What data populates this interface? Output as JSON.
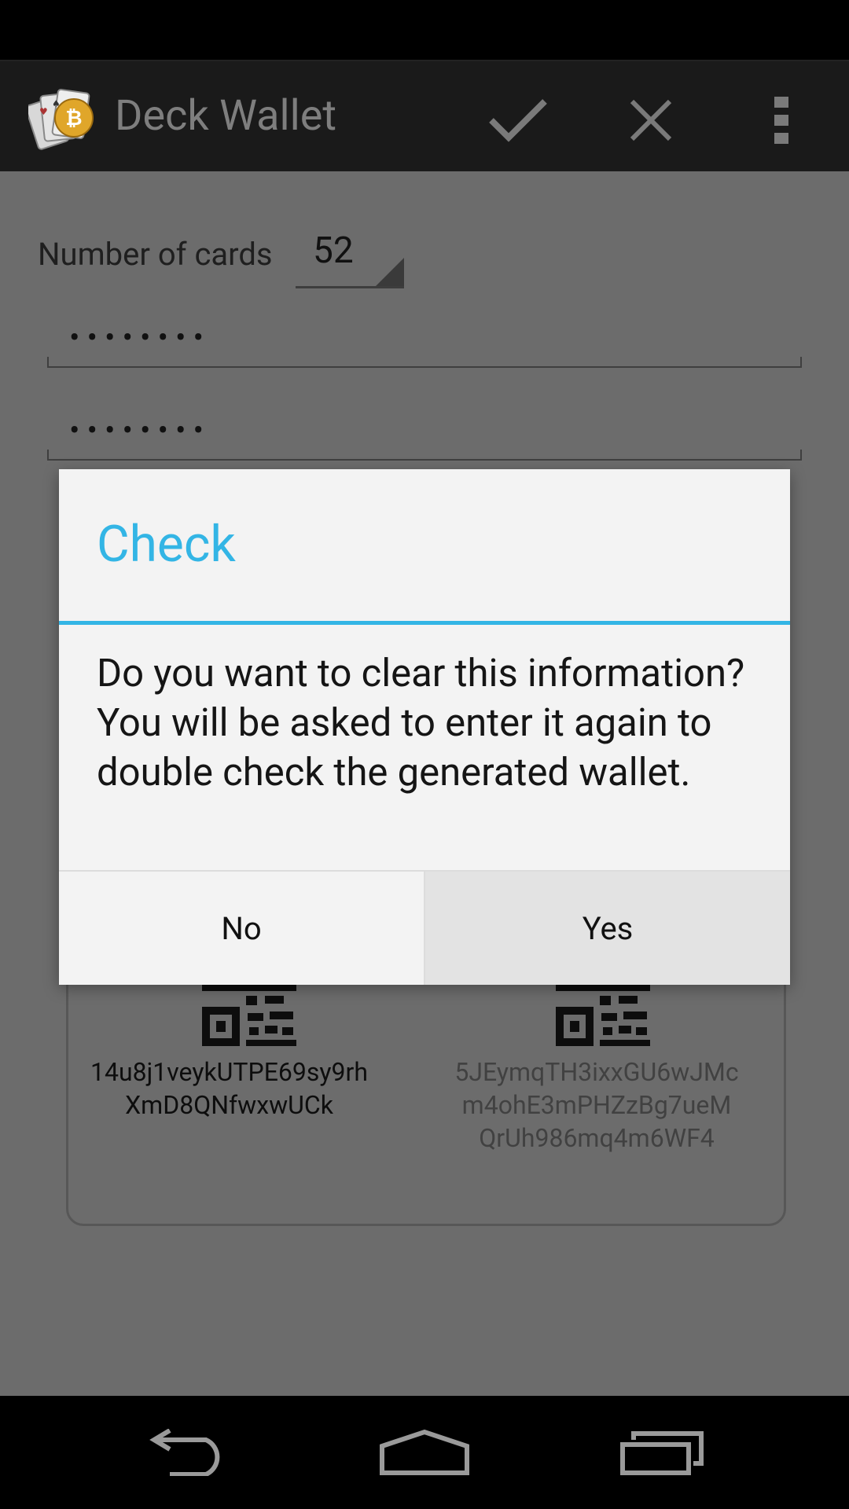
{
  "app": {
    "title": "Deck Wallet",
    "icons": [
      "playing-cards-bitcoin-icon",
      "checkmark-icon",
      "close-icon",
      "overflow-menu-icon"
    ]
  },
  "form": {
    "cards_label": "Number of cards",
    "cards_value": "52",
    "password_mask": "••••••••",
    "password_confirm_mask": "••••••••"
  },
  "wallet": {
    "public_address_lines": [
      "14u8j1veykUTPE69sy9rh",
      "XmD8QNfwxwUCk"
    ],
    "private_key_lines": [
      "5JEymqTH3ixxGU6wJMc",
      "m4ohE3mPHZzBg7ueM",
      "QrUh986mq4m6WF4"
    ]
  },
  "dialog": {
    "title": "Check",
    "message": "Do you want to clear this information? You will be asked to enter it again to double check the generated wallet.",
    "no_label": "No",
    "yes_label": "Yes"
  },
  "navigation": {
    "icons": [
      "back-icon",
      "home-icon",
      "recent-apps-icon"
    ]
  },
  "colors": {
    "accent": "#33b5e5",
    "dim_overlay": "#6c6c6c",
    "action_bar": "#1a1a1a"
  }
}
